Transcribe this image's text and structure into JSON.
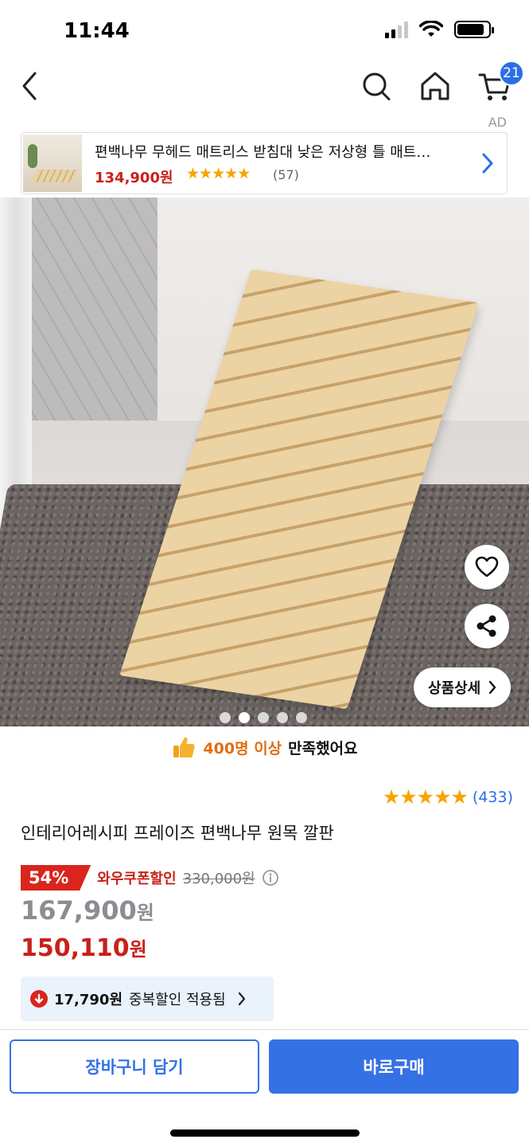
{
  "status_bar": {
    "time": "11:44"
  },
  "nav": {
    "cart_count": "21"
  },
  "ad": {
    "label": "AD",
    "title": "편백나무 무헤드 매트리스 받침대 낮은 저상형 틀 매트…",
    "price": "134,900원",
    "stars": "★★★★★",
    "review_count": "(57)"
  },
  "gallery": {
    "dot_count": 5,
    "active_dot": 1
  },
  "image_buttons": {
    "detail_label": "상품상세"
  },
  "satisfaction": {
    "highlight": "400명 이상",
    "rest": "만족했어요"
  },
  "rating": {
    "stars": "★★★★★",
    "count": "(433)"
  },
  "product": {
    "title": "인테리어레시피 프레이즈 편백나무 원목 깔판",
    "discount_percent": "54%",
    "coupon_label": "와우쿠폰할인",
    "original_price": "330,000원",
    "sale_price_number": "167,900",
    "sale_price_unit": "원",
    "final_price_number": "150,110",
    "final_price_unit": "원"
  },
  "duplicate_discount": {
    "amount": "17,790원",
    "text": "중복할인 적용됨"
  },
  "bottom_bar": {
    "cart_label": "장바구니 담기",
    "buy_label": "바로구매"
  },
  "colors": {
    "accent": "#3471e5",
    "price_red": "#c8211a",
    "star": "#f7a300"
  }
}
